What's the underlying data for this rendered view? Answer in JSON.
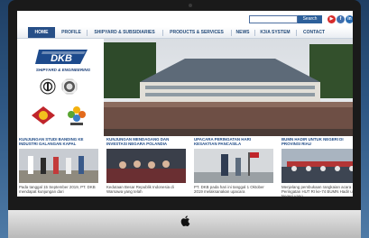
{
  "header": {
    "search_placeholder": "",
    "search_button": "Search",
    "social": [
      "youtube-icon",
      "facebook-icon",
      "linkedin-icon"
    ],
    "nav": [
      "HOME",
      "PROFILE",
      "SHIPYARD & SUBSIDIARIES",
      "PRODUCTS & SERVICES",
      "NEWS",
      "K3/A SYSTEM",
      "CONTACT"
    ],
    "active_nav": "HOME"
  },
  "sidebar": {
    "logo_text": "DKB",
    "tagline": "SHIPYARD & ENGINEERING"
  },
  "news": [
    {
      "title": "KUNJUNGAN STUDI BANDING KE INDUSTRI GALANGAN KAPAL",
      "snippet": "Pada tanggal 15 September 2019, PT. DKB mendapat kunjungan dari"
    },
    {
      "title": "KUNJUNGAN MENDAGANG DAN INVESTASI NEGARA POLANDIA",
      "snippet": "Kedutaan Besar Republik Indonesia di Warsawa yang telah"
    },
    {
      "title": "UPACARA PERINGATAN HARI KESAKTIAN PANCASILA",
      "snippet": "PT. DKB pada hari ini tanggal 1 Oktober 2019 melaksanakan upacara"
    },
    {
      "title": "BUMN HADIR UNTUK NEGERI DI PROVINSI RIAU",
      "snippet": "Menjelang pembukaan rangkaian acara Peringatan HUT RI ke-74 BUMN Hadir untuk Negeri yang"
    }
  ],
  "colors": {
    "nav_active": "#274f87",
    "link": "#1e4a86",
    "brand_red": "#c0252b"
  }
}
